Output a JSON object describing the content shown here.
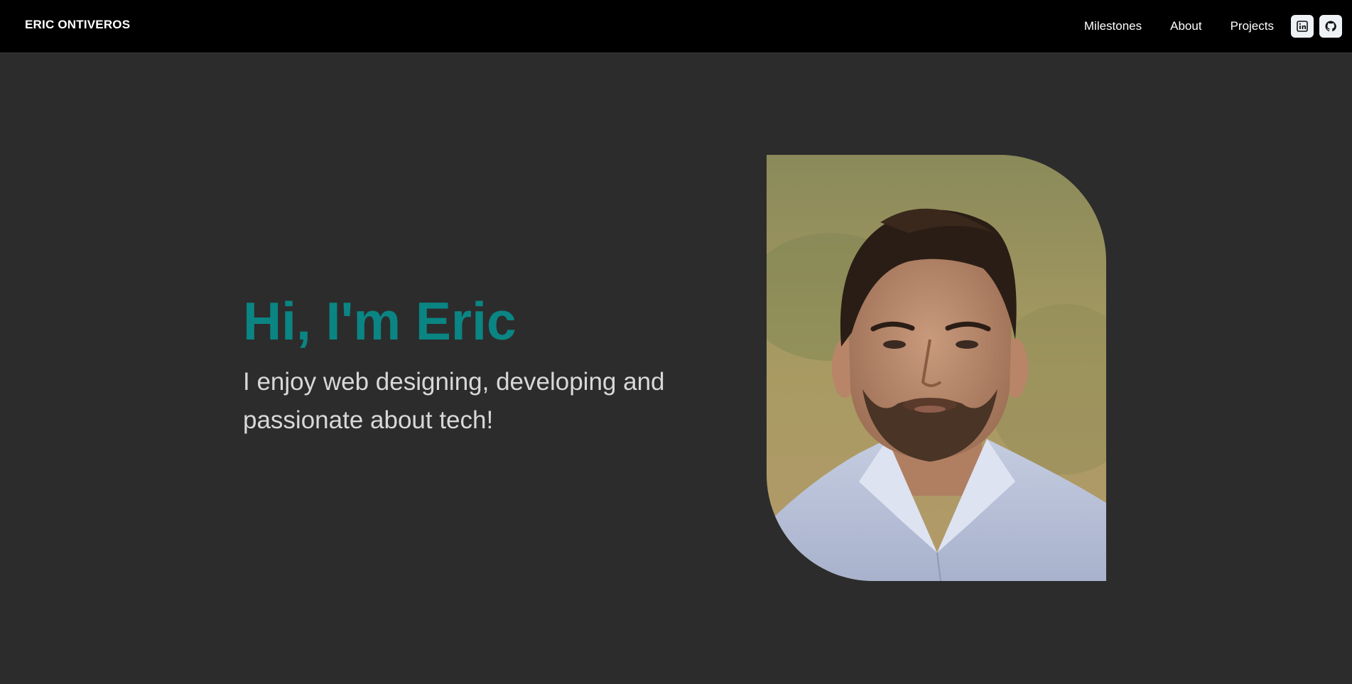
{
  "nav": {
    "brand": "ERIC ONTIVEROS",
    "links": [
      {
        "label": "Milestones"
      },
      {
        "label": "About"
      },
      {
        "label": "Projects"
      }
    ],
    "social": [
      {
        "icon": "linkedin-icon"
      },
      {
        "icon": "github-icon"
      }
    ]
  },
  "hero": {
    "heading": "Hi, I'm Eric",
    "subheading": "I enjoy web designing, developing and passionate about tech!"
  },
  "colors": {
    "background": "#2c2c2c",
    "navbar": "#000000",
    "accent": "#0a8583",
    "text": "#d8d8d8"
  }
}
